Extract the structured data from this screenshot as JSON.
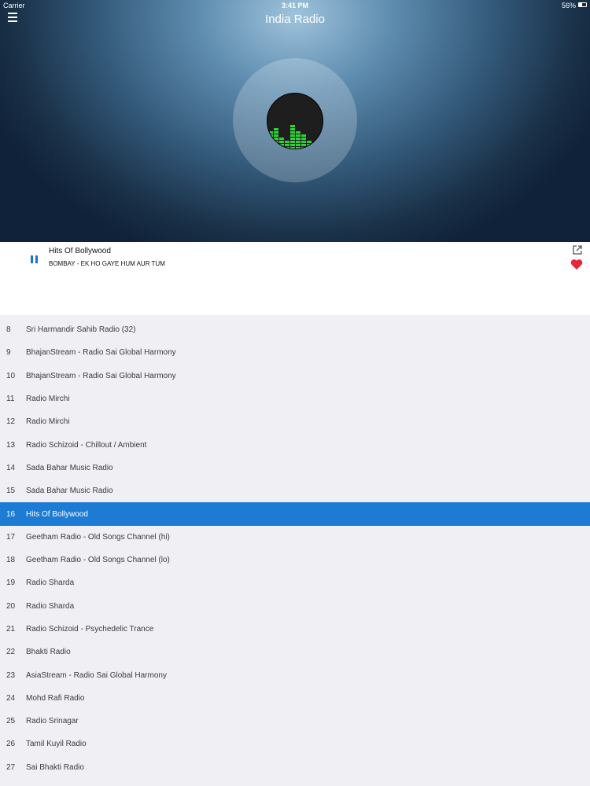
{
  "status_bar": {
    "carrier": "Carrier",
    "time": "3:41 PM",
    "battery": "56%"
  },
  "header": {
    "title": "India Radio"
  },
  "now_playing": {
    "station": "Hits Of Bollywood",
    "song": "BOMBAY - EK HO GAYE HUM AUR TUM",
    "favorite_color": "#e8253a"
  },
  "accent_color": "#1d7bd4",
  "stations": [
    {
      "num": "8",
      "name": "Sri Harmandir Sahib Radio (32)",
      "active": false
    },
    {
      "num": "9",
      "name": "BhajanStream - Radio Sai Global Harmony",
      "active": false
    },
    {
      "num": "10",
      "name": "BhajanStream - Radio Sai Global Harmony",
      "active": false
    },
    {
      "num": "11",
      "name": "Radio Mirchi",
      "active": false
    },
    {
      "num": "12",
      "name": "Radio Mirchi",
      "active": false
    },
    {
      "num": "13",
      "name": "Radio Schizoid - Chillout / Ambient",
      "active": false
    },
    {
      "num": "14",
      "name": "Sada Bahar Music Radio",
      "active": false
    },
    {
      "num": "15",
      "name": "Sada Bahar Music Radio",
      "active": false
    },
    {
      "num": "16",
      "name": "Hits Of Bollywood",
      "active": true
    },
    {
      "num": "17",
      "name": "Geetham Radio - Old Songs Channel (hi)",
      "active": false
    },
    {
      "num": "18",
      "name": "Geetham Radio - Old Songs Channel (lo)",
      "active": false
    },
    {
      "num": "19",
      "name": "Radio Sharda",
      "active": false
    },
    {
      "num": "20",
      "name": "Radio Sharda",
      "active": false
    },
    {
      "num": "21",
      "name": "Radio Schizoid - Psychedelic Trance",
      "active": false
    },
    {
      "num": "22",
      "name": "Bhakti Radio",
      "active": false
    },
    {
      "num": "23",
      "name": "AsiaStream - Radio Sai Global Harmony",
      "active": false
    },
    {
      "num": "24",
      "name": "Mohd Rafi Radio",
      "active": false
    },
    {
      "num": "25",
      "name": "Radio Srinagar",
      "active": false
    },
    {
      "num": "26",
      "name": "Tamil Kuyil Radio",
      "active": false
    },
    {
      "num": "27",
      "name": "Sai Bhakti Radio",
      "active": false
    }
  ]
}
